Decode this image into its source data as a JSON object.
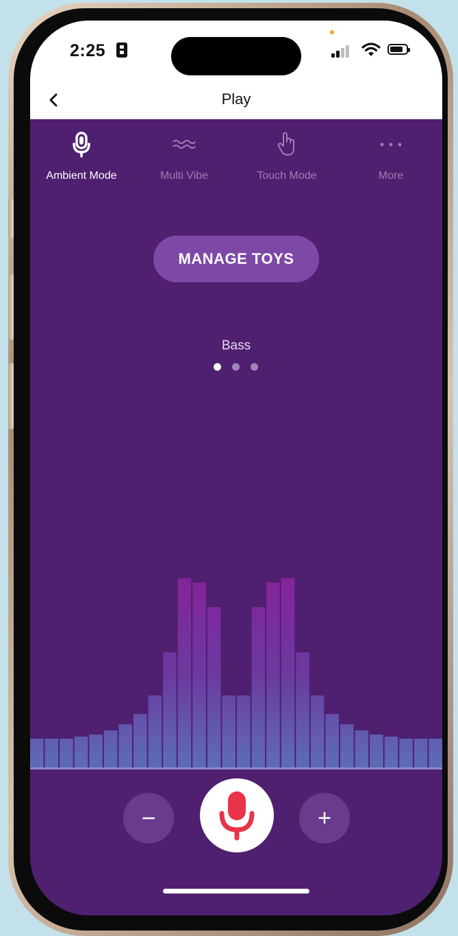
{
  "status_bar": {
    "time": "2:25"
  },
  "header": {
    "title": "Play",
    "back_icon": "chevron-left-icon"
  },
  "tabs": [
    {
      "label": "Ambient Mode",
      "icon": "microphone-icon",
      "active": true
    },
    {
      "label": "Multi Vibe",
      "icon": "waves-icon",
      "active": false
    },
    {
      "label": "Touch Mode",
      "icon": "hand-pointer-icon",
      "active": false
    },
    {
      "label": "More",
      "icon": "more-dots-icon",
      "active": false
    }
  ],
  "main": {
    "manage_toys_label": "MANAGE TOYS",
    "preset_label": "Bass",
    "page_count": 3,
    "active_page": 1
  },
  "visualizer": {
    "levels": [
      0.14,
      0.14,
      0.14,
      0.15,
      0.16,
      0.18,
      0.21,
      0.26,
      0.35,
      0.56,
      0.92,
      0.9,
      0.78,
      0.35,
      0.35,
      0.78,
      0.9,
      0.92,
      0.56,
      0.35,
      0.26,
      0.21,
      0.18,
      0.16,
      0.15,
      0.14,
      0.14,
      0.14
    ]
  },
  "controls": {
    "decrease_symbol": "−",
    "increase_symbol": "+",
    "mic_icon": "microphone-icon"
  },
  "colors": {
    "background": "#4f1f70",
    "accent_button": "#7e49a6",
    "mic_red": "#e8344a",
    "bar_top": "#8a1f9a",
    "bar_bottom": "#5c6db8"
  }
}
